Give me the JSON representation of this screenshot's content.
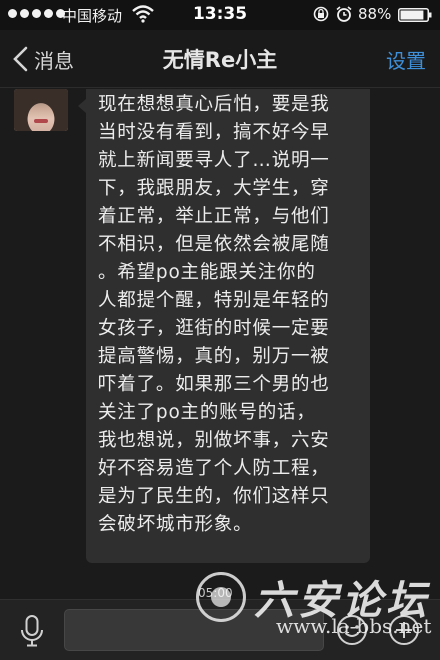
{
  "status_bar": {
    "carrier": "中国移动",
    "time": "13:35",
    "battery_percent": "88%",
    "signal_dots": 5,
    "icons": [
      "signal-dots-icon",
      "wifi-icon",
      "rotation-lock-icon",
      "alarm-icon",
      "battery-icon"
    ],
    "battery_level": 0.88
  },
  "nav": {
    "back_label": "消息",
    "title": "无情Re小主",
    "settings_label": "设置",
    "accent_color": "#3d8fd9"
  },
  "message": {
    "lines": [
      "现在想想真心后怕，要是我",
      "当时没有看到，搞不好今早",
      "就上新闻要寻人了…说明一",
      "下，我跟朋友，大学生，穿",
      "着正常，举止正常，与他们",
      "不相识，但是依然会被尾随",
      "。希望po主能跟关注你的",
      "人都提个醒，特别是年轻的",
      "女孩子，逛街的时候一定要",
      "提高警惕，真的，别万一被",
      "吓着了。如果那三个男的也",
      "关注了po主的账号的话，",
      "我也想说，别做坏事，六安",
      "好不容易造了个人防工程，",
      "是为了民生的，你们这样只",
      "会破坏城市形象。"
    ]
  },
  "input_bar": {
    "icons": [
      "microphone-icon",
      "emoji-icon",
      "plus-icon"
    ]
  },
  "watermark": {
    "brand": "六安论坛",
    "url": "www.la-bbs.net",
    "seal_text": "05:00"
  }
}
